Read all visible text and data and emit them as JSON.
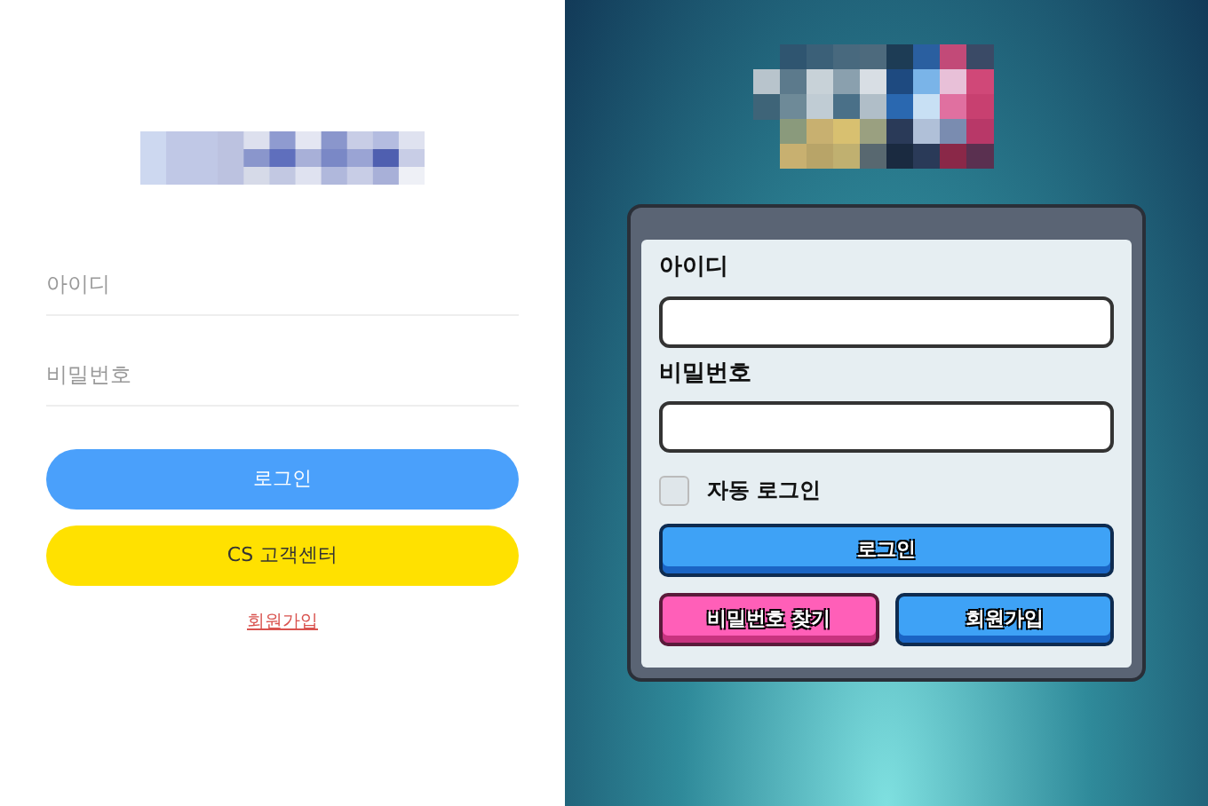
{
  "web_login": {
    "id_field": {
      "placeholder": "아이디"
    },
    "password_field": {
      "placeholder": "비밀번호"
    },
    "buttons": [
      {
        "label": "로그인",
        "kind": "primary"
      },
      {
        "label": "CS 고객센터",
        "kind": "support"
      }
    ],
    "signup_link": "회원가입"
  },
  "game_login": {
    "id_label": "아이디",
    "password_label": "비밀번호",
    "auto_login": {
      "label": "자동 로그인",
      "checked": false
    },
    "login_button": "로그인",
    "buttons": [
      {
        "label": "비밀번호 찾기",
        "kind": "pink"
      },
      {
        "label": "회원가입",
        "kind": "blue"
      }
    ]
  }
}
